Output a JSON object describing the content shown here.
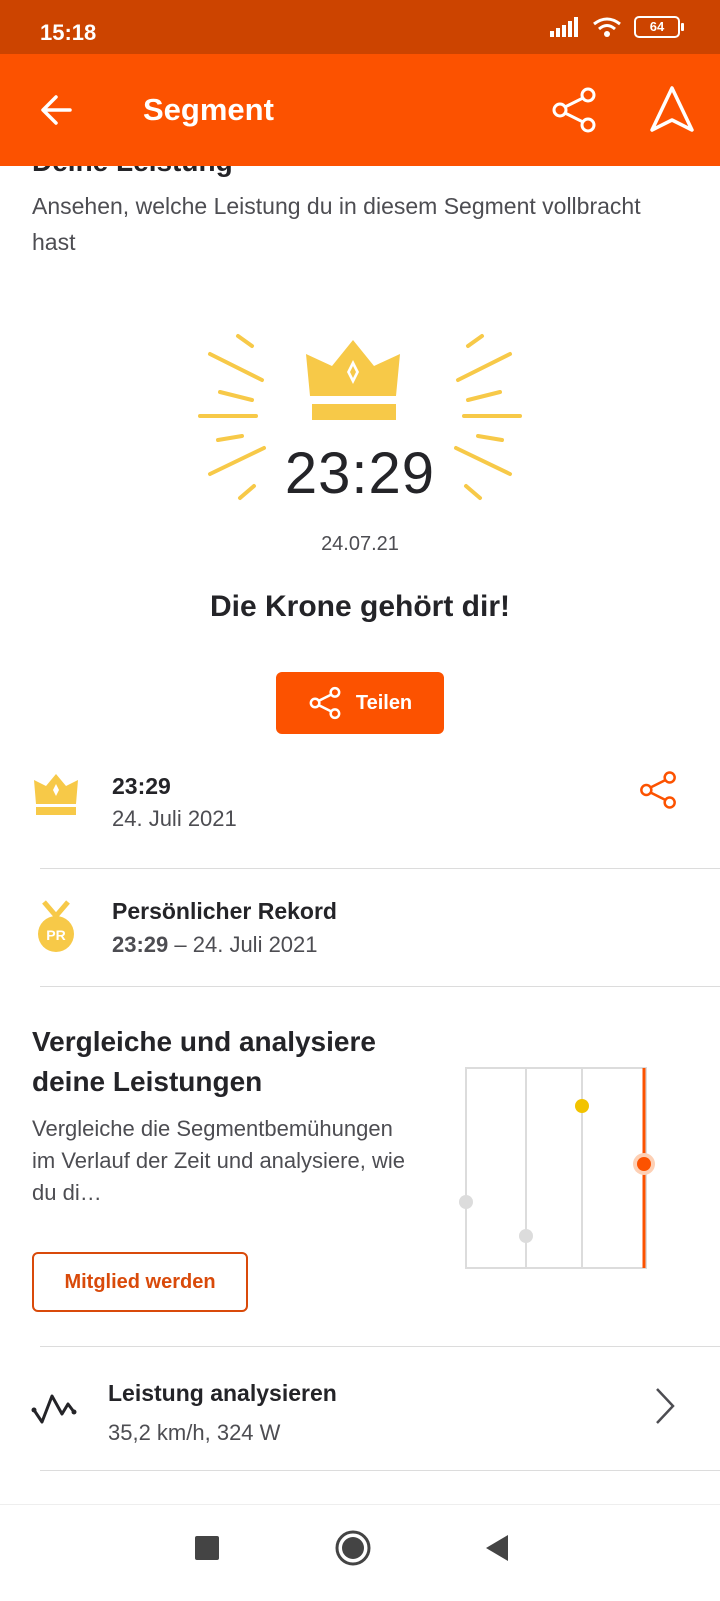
{
  "status": {
    "time": "15:18",
    "battery": "64"
  },
  "appbar": {
    "title": "Segment"
  },
  "section": {
    "heading_partial": "Deine Leistung",
    "subtitle": "Ansehen, welche Leistung du in diesem Segment vollbracht hast"
  },
  "hero": {
    "time": "23:29",
    "date": "24.07.21",
    "headline": "Die Krone gehört dir!",
    "share_label": "Teilen"
  },
  "crown_row": {
    "time": "23:29",
    "date": "24. Juli 2021"
  },
  "pr_row": {
    "title": "Persönlicher Rekord",
    "time": "23:29",
    "separator": " – ",
    "date": "24. Juli 2021",
    "badge": "PR"
  },
  "compare": {
    "title": "Vergleiche und analysiere deine Leistungen",
    "description": "Vergleiche die Segmentbemühungen im Verlauf der Zeit und analysiere, wie du di…",
    "button": "Mitglied werden"
  },
  "analyze_row": {
    "title": "Leistung analysieren",
    "subtitle": "35,2 km/h, 324 W"
  },
  "colors": {
    "brand": "#fc5200",
    "statusbar": "#cc4400",
    "gold": "#f7c948"
  },
  "icons": [
    "back-arrow-icon",
    "share-icon",
    "navigate-icon",
    "crown-icon",
    "pr-medal-icon",
    "activity-icon",
    "chevron-right-icon"
  ]
}
